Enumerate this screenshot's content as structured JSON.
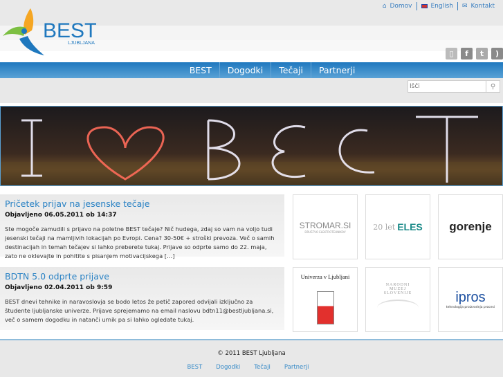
{
  "header": {
    "logo_text": "BEST",
    "logo_sub": "LJUBLJANA",
    "top_links": [
      {
        "label": "Domov",
        "icon": "home-icon"
      },
      {
        "label": "English",
        "icon": "uk-flag-icon"
      },
      {
        "label": "Kontakt",
        "icon": "mail-icon"
      }
    ],
    "social": [
      "youtube-icon",
      "facebook-icon",
      "twitter-icon",
      "rss-icon"
    ]
  },
  "nav": [
    "BEST",
    "Dogodki",
    "Tečaji",
    "Partnerji"
  ],
  "search": {
    "placeholder": "Išči"
  },
  "posts": [
    {
      "title": "Pričetek prijav na jesenske tečaje",
      "date": "Objavljeno 06.05.2011 ob 14:37",
      "body": "Ste mogoče zamudili s prijavo na poletne BEST tečaje? Nič hudega, zdaj so vam na voljo tudi jesenski tečaji na mamljivih lokacijah po Evropi. Cena? 30-50€ + stroški prevoza. Več o samih destinacijah in temah tečajev si lahko preberete tukaj. Prijave so odprte samo do 22. maja, zato ne oklevajte in pohitite s pisanjem motivacijskega […]"
    },
    {
      "title": "BDTN 5.0 odprte prijave",
      "date": "Objavljeno 02.04.2011 ob 9:59",
      "body": "BEST dnevi tehnike in naravoslovja se bodo letos že petič zapored odvijali izključno za študente ljubljanske univerze. Prijave sprejemamo na email naslovu bdtn11@bestljubljana.si, več o samem dogodku in natanči urnik pa si lahko ogledate tukaj."
    }
  ],
  "partners": [
    {
      "name": "STROMAR.SI",
      "sub": "DRUŠTVO ELEKTROTEHNIKOV"
    },
    {
      "name": "ELES",
      "sub": "20 let"
    },
    {
      "name": "gorenje",
      "sub": ""
    },
    {
      "name": "Univerza v Ljubljani",
      "sub": ""
    },
    {
      "name": "NARODNI MUZEJ SLOVENIJE",
      "sub": ""
    },
    {
      "name": "ipros",
      "sub": "tehnologija proizvodnja procesi"
    }
  ],
  "footer": {
    "copyright": "© 2011 BEST Ljubljana",
    "links": [
      "BEST",
      "Dogodki",
      "Tečaji",
      "Partnerji"
    ]
  },
  "colors": {
    "accent": "#2a82c4",
    "nav": "#1f78be"
  }
}
